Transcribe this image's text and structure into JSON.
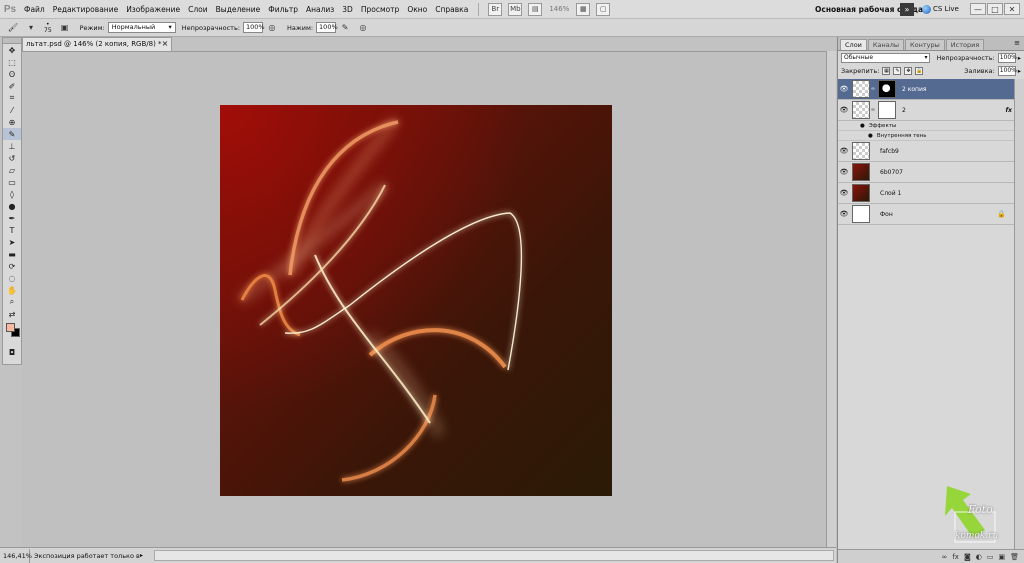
{
  "app": {
    "logo": "Ps",
    "menu": [
      "Файл",
      "Редактирование",
      "Изображение",
      "Слои",
      "Выделение",
      "Фильтр",
      "Анализ",
      "3D",
      "Просмотр",
      "Окно",
      "Справка"
    ],
    "zoom_display": "146%",
    "workspace": "Основная рабочая среда",
    "cslive": "CS Live",
    "window_buttons": [
      "—",
      "□",
      "✕"
    ]
  },
  "options": {
    "brush_size": "75",
    "mode_label": "Режим:",
    "mode_value": "Нормальный",
    "opacity_label": "Непрозрачность:",
    "opacity_value": "100%",
    "pressure_label": "Нажим:",
    "pressure_value": "100%"
  },
  "document": {
    "tab_title": "льтат.psd @ 146% (2 копия, RGB/8) *",
    "close": "×"
  },
  "status": {
    "zoom": "146,41%",
    "info": "Экспозиция работает только в ..."
  },
  "panel": {
    "tabs": [
      "Слои",
      "Каналы",
      "Контуры",
      "История"
    ],
    "blend_mode": "Обычные",
    "opacity_label": "Непрозрачность:",
    "opacity_value": "100%",
    "lock_label": "Закрепить:",
    "fill_label": "Заливка:",
    "fill_value": "100%",
    "layers": [
      {
        "name": "2 копия",
        "selected": true
      },
      {
        "name": "2",
        "fx": "fx"
      },
      {
        "name": "fafcb9"
      },
      {
        "name": "6b0707"
      },
      {
        "name": "Слой 1"
      },
      {
        "name": "Фон",
        "locked": true
      }
    ],
    "effects_label": "Эффекты",
    "effect_inner_shadow": "Внутренняя тень"
  },
  "watermark": {
    "line1": "Foto",
    "line2": "komok.ru"
  },
  "colors": {
    "foreground": "#f7b9a0",
    "background": "#000000",
    "selected_layer": "#546a91"
  }
}
